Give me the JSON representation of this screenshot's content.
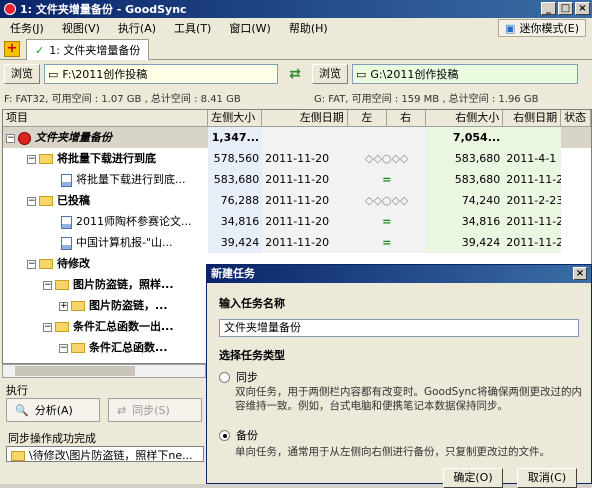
{
  "window": {
    "title": "1: 文件夹增量备份 - GoodSync",
    "min": "_",
    "max": "□",
    "close": "×"
  },
  "menu": [
    "任务(J)",
    "视图(V)",
    "执行(A)",
    "工具(T)",
    "窗口(W)",
    "帮助(H)"
  ],
  "expert_mode": "迷你模式(E)",
  "tab": {
    "label": "1: 文件夹增量备份"
  },
  "left": {
    "browse": "浏览",
    "path": "F:\\2011创作投稿",
    "fs": "F: FAT32, 可用空间 : 1.07 GB , 总计空间 : 8.41 GB"
  },
  "right": {
    "browse": "浏览",
    "path": "G:\\2011创作投稿",
    "fs": "G: FAT, 可用空间 : 159 MB , 总计空间 : 1.96 GB"
  },
  "columns": {
    "item": "项目",
    "lsize": "左侧大小",
    "ldate": "左侧日期",
    "l": "左",
    "r": "右",
    "rsize": "右侧大小",
    "rdate": "右侧日期",
    "status": "状态"
  },
  "rows": [
    {
      "name": "文件夹增量备份",
      "lsize": "1,347...",
      "ldate": "",
      "act": "",
      "rsize": "7,054...",
      "rdate": ""
    },
    {
      "name": "将批量下载进行到底",
      "lsize": "578,560",
      "ldate": "2011-11-20",
      "act": "◇◇○◇◇",
      "rsize": "583,680",
      "rdate": "2011-4-1"
    },
    {
      "name": "将批量下载进行到底...",
      "lsize": "583,680",
      "ldate": "2011-11-20",
      "act": "=",
      "rsize": "583,680",
      "rdate": "2011-11-2..."
    },
    {
      "name": "已投稿",
      "lsize": "76,288",
      "ldate": "2011-11-20",
      "act": "◇◇○◇◇",
      "rsize": "74,240",
      "rdate": "2011-2-23..."
    },
    {
      "name": "2011师陶杯参赛论文...",
      "lsize": "34,816",
      "ldate": "2011-11-20",
      "act": "=",
      "rsize": "34,816",
      "rdate": "2011-11-2..."
    },
    {
      "name": "中国计算机报-\"山...",
      "lsize": "39,424",
      "ldate": "2011-11-20",
      "act": "=",
      "rsize": "39,424",
      "rdate": "2011-11-2..."
    },
    {
      "name": "待修改",
      "lsize": "",
      "ldate": "",
      "act": "",
      "rsize": "",
      "rdate": ""
    },
    {
      "name": "图片防盗链，照样...",
      "lsize": "",
      "ldate": "",
      "act": "",
      "rsize": "",
      "rdate": ""
    },
    {
      "name": "图片防盗链，...",
      "lsize": "",
      "ldate": "",
      "act": "",
      "rsize": "",
      "rdate": ""
    },
    {
      "name": "条件汇总函数一出...",
      "lsize": "",
      "ldate": "",
      "act": "",
      "rsize": "",
      "rdate": ""
    },
    {
      "name": "条件汇总函数...",
      "lsize": "",
      "ldate": "",
      "act": "",
      "rsize": "",
      "rdate": ""
    }
  ],
  "exec": {
    "label": "执行",
    "analyze": "分析(A)",
    "sync": "同步(S)",
    "status": "同步操作成功完成",
    "path": "\\待修改\\图片防盗链，照样下ne..."
  },
  "dialog": {
    "title": "新建任务",
    "close": "×",
    "name_label": "输入任务名称",
    "name_value": "文件夹增量备份",
    "type_label": "选择任务类型",
    "opt1": "同步",
    "opt1_desc": "双向任务，用于两侧栏内容都有改变时。GoodSync将确保两侧更改过的内容维持一致。例如，台式电脑和便携笔记本数据保持同步。",
    "opt2": "备份",
    "opt2_desc": "单向任务，通常用于从左侧向右侧进行备份，只复制更改过的文件。",
    "ok": "确定(O)",
    "cancel": "取消(C)"
  }
}
